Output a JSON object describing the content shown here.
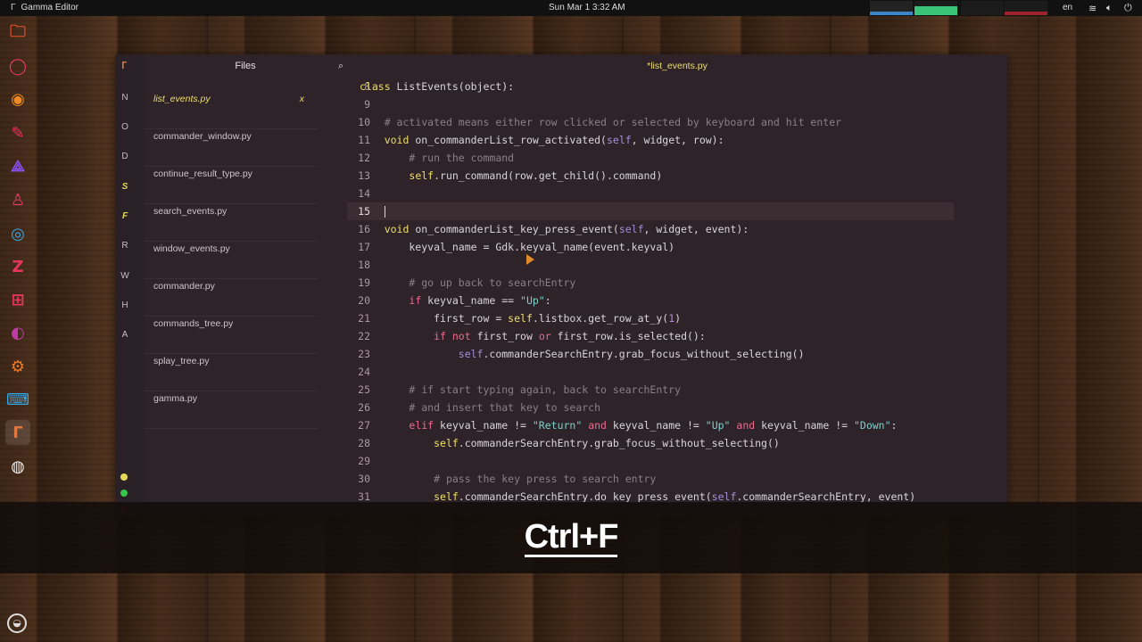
{
  "topbar": {
    "app_title": "Gamma Editor",
    "clock": "Sun Mar 1   3:32 AM",
    "language": "en",
    "wifi_icon": "wifi-icon",
    "volume_icon": "volume-icon",
    "power_icon": "power-icon"
  },
  "dock": [
    {
      "name": "files-icon",
      "glyph": "🗀",
      "color": "#e8532f"
    },
    {
      "name": "opera-icon",
      "glyph": "◯",
      "color": "#e83a6a"
    },
    {
      "name": "firefox-icon",
      "glyph": "◉",
      "color": "#f08a24"
    },
    {
      "name": "text-editor-icon",
      "glyph": "✎",
      "color": "#e8345a"
    },
    {
      "name": "vscode-icon",
      "glyph": "⟁",
      "color": "#8a4ff0"
    },
    {
      "name": "inkscape-icon",
      "glyph": "♙",
      "color": "#e83a6a"
    },
    {
      "name": "owl-icon",
      "glyph": "◎",
      "color": "#3aa8e8"
    },
    {
      "name": "filezilla-icon",
      "glyph": "Z",
      "color": "#e8345a"
    },
    {
      "name": "calculator-icon",
      "glyph": "⊞",
      "color": "#e8345a"
    },
    {
      "name": "toggle-icon",
      "glyph": "◐",
      "color": "#c03aa8"
    },
    {
      "name": "settings-icon",
      "glyph": "⚙",
      "color": "#f07a2a"
    },
    {
      "name": "terminal-icon",
      "glyph": "⌨",
      "color": "#3aa8e8"
    },
    {
      "name": "gamma-editor-icon",
      "glyph": "Γ",
      "color": "#e0773f"
    },
    {
      "name": "obs-icon",
      "glyph": "◍",
      "color": "#eeeeee"
    }
  ],
  "rail": {
    "logo": "Γ",
    "letters": [
      "N",
      "O",
      "D",
      "S",
      "F",
      "R",
      "W",
      "H",
      "A"
    ],
    "highlighted": [
      "S",
      "F"
    ],
    "dot_colors": [
      "#e6d95a",
      "#39c44a",
      "#a0222a"
    ]
  },
  "sidebar": {
    "title": "Files",
    "search_icon": "search-icon",
    "files": [
      "list_events.py",
      "commander_window.py",
      "continue_result_type.py",
      "search_events.py",
      "window_events.py",
      "commander.py",
      "commands_tree.py",
      "splay_tree.py",
      "gamma.py"
    ],
    "active_close": "x"
  },
  "editor": {
    "tab_title": "*list_events.py",
    "current_line": 15,
    "lines": [
      {
        "n": 8,
        "html": "<span class='kw'>class</span> ListEvents(object):"
      },
      {
        "n": 9,
        "html": ""
      },
      {
        "n": 10,
        "html": "    <span class='cm'># activated means either row clicked or selected by keyboard and hit enter</span>"
      },
      {
        "n": 11,
        "html": "    <span class='kw'>void</span> on_commanderList_row_activated(<span class='sf'>self</span>, widget, row):"
      },
      {
        "n": 12,
        "html": "        <span class='cm'># run the command</span>"
      },
      {
        "n": 13,
        "html": "        <span class='kw'>self</span>.run_command(row.get_child().command)"
      },
      {
        "n": 14,
        "html": ""
      },
      {
        "n": 15,
        "html": "    <span class='caret'></span>"
      },
      {
        "n": 16,
        "html": "    <span class='kw'>void</span> on_commanderList_key_press_event(<span class='sf'>self</span>, widget, event):"
      },
      {
        "n": 17,
        "html": "        keyval_name = Gdk.keyval_name(event.keyval)"
      },
      {
        "n": 18,
        "html": ""
      },
      {
        "n": 19,
        "html": "        <span class='cm'># go up back to searchEntry</span>"
      },
      {
        "n": 20,
        "html": "        <span class='op'>if</span> keyval_name == <span class='st'>\"Up\"</span>:"
      },
      {
        "n": 21,
        "html": "            first_row = <span class='kw'>self</span>.listbox.get_row_at_y(<span class='nm'>1</span>)"
      },
      {
        "n": 22,
        "html": "            <span class='op'>if not</span> first_row <span class='op'>or</span> first_row.is_selected():"
      },
      {
        "n": 23,
        "html": "                <span class='sf'>self</span>.commanderSearchEntry.grab_focus_without_selecting()"
      },
      {
        "n": 24,
        "html": ""
      },
      {
        "n": 25,
        "html": "        <span class='cm'># if start typing again, back to searchEntry</span>"
      },
      {
        "n": 26,
        "html": "        <span class='cm'># and insert that key to search</span>"
      },
      {
        "n": 27,
        "html": "        <span class='op'>elif</span> keyval_name != <span class='st'>\"Return\"</span> <span class='op'>and</span> keyval_name != <span class='st'>\"Up\"</span> <span class='op'>and</span> keyval_name != <span class='st'>\"Down\"</span>:"
      },
      {
        "n": 28,
        "html": "            <span class='kw'>self</span>.commanderSearchEntry.grab_focus_without_selecting()"
      },
      {
        "n": 29,
        "html": ""
      },
      {
        "n": 30,
        "html": "            <span class='cm'># pass the key press to search entry</span>"
      },
      {
        "n": 31,
        "html": "            <span class='kw'>self</span>.commanderSearchEntry.do_key_press_event(<span class='sf'>self</span>.commanderSearchEntry, event)"
      }
    ]
  },
  "overlay": {
    "shortcut": "Ctrl+F"
  },
  "colors": {
    "accent": "#f0df6a",
    "editor_bg": "#2d2328",
    "comment": "#8c7f86",
    "string": "#7fd2cc",
    "operator": "#ee6b8e"
  }
}
